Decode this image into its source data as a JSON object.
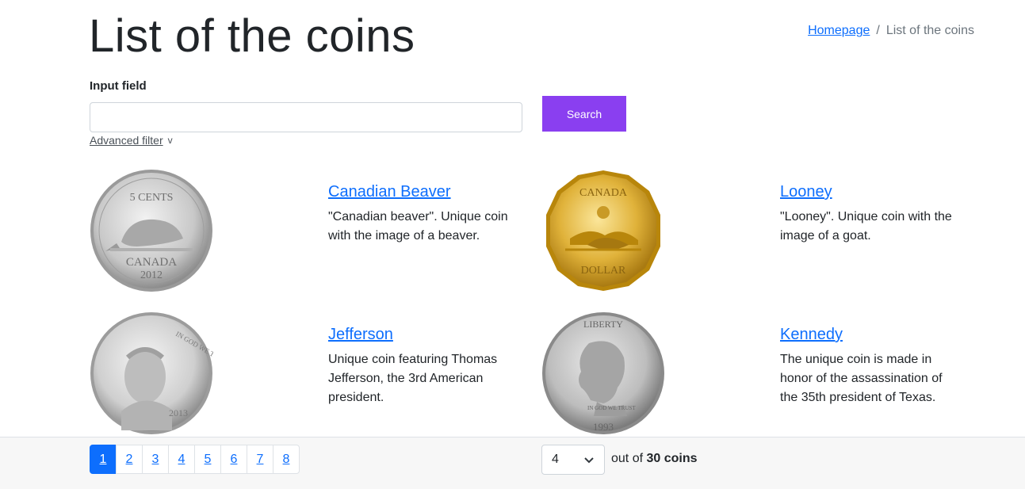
{
  "header": {
    "title": "List of the coins"
  },
  "breadcrumb": {
    "home": "Homepage",
    "separator": "/",
    "current": "List of the coins"
  },
  "search": {
    "label": "Input field",
    "value": "",
    "placeholder": "",
    "button": "Search",
    "advanced_filter": "Advanced filter",
    "advanced_chevron": "v"
  },
  "coins": [
    {
      "title": "Canadian Beaver",
      "description": "\"Canadian beaver\". Unique coin with the image of a beaver.",
      "image": "canadian-beaver-coin",
      "coin_text_top": "5 CENTS",
      "coin_text_bottom": "CANADA",
      "coin_year": "2012"
    },
    {
      "title": "Looney",
      "description": "\"Looney\". Unique coin with the image of a goat.",
      "image": "looney-coin",
      "coin_text_top": "CANADA",
      "coin_text_bottom": "DOLLAR"
    },
    {
      "title": "Jefferson",
      "description": "Unique coin featuring Thomas Jefferson, the 3rd American president.",
      "image": "jefferson-coin",
      "coin_text_top": "IN GOD WE TRUST",
      "coin_year": "2013"
    },
    {
      "title": "Kennedy",
      "description": "The unique coin is made in honor of the assassination of the 35th president of Texas.",
      "image": "kennedy-coin",
      "coin_text_top": "LIBERTY",
      "coin_text_bottom": "IN GOD WE TRUST",
      "coin_year": "1993"
    }
  ],
  "pagination": {
    "pages": [
      "1",
      "2",
      "3",
      "4",
      "5",
      "6",
      "7",
      "8"
    ],
    "active": "1"
  },
  "per_page": {
    "selected": "4"
  },
  "count": {
    "prefix": "out of",
    "total": "30",
    "suffix": "coins"
  },
  "colors": {
    "accent": "#8a3ff0",
    "link": "#0d6efd",
    "gold": "#e0b23a",
    "silver": "#c9c9c9"
  }
}
